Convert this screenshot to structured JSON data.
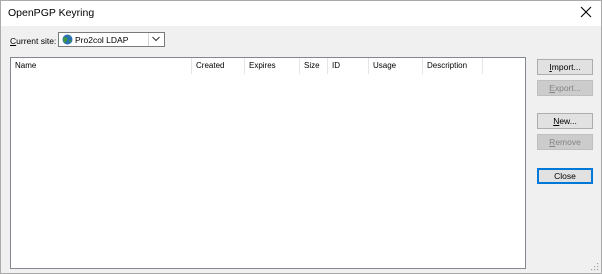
{
  "window": {
    "title": "OpenPGP Keyring"
  },
  "site": {
    "label_mnemonic": "C",
    "label_rest": "urrent site:",
    "selected": "Pro2col LDAP"
  },
  "table": {
    "columns": [
      {
        "label": "Name"
      },
      {
        "label": "Created"
      },
      {
        "label": "Expires"
      },
      {
        "label": "Size"
      },
      {
        "label": "ID"
      },
      {
        "label": "Usage"
      },
      {
        "label": "Description"
      }
    ],
    "rows": []
  },
  "buttons": {
    "import": {
      "mnemonic": "I",
      "rest": "mport...",
      "enabled": true
    },
    "export": {
      "mnemonic": "E",
      "rest": "xport...",
      "enabled": false
    },
    "new": {
      "mnemonic": "N",
      "rest": "ew...",
      "enabled": true
    },
    "remove": {
      "mnemonic": "R",
      "rest": "emove",
      "enabled": false
    },
    "close": {
      "label": "Close",
      "enabled": true,
      "default": true
    }
  },
  "icons": {
    "close": "close-icon",
    "site": "globe-icon",
    "dropdown": "chevron-down-icon",
    "resize": "resize-grip-icon"
  },
  "colors": {
    "dialog_bg": "#f0f0f0",
    "list_bg": "#ffffff",
    "default_button_border": "#0078d7",
    "disabled_text": "#838383"
  }
}
